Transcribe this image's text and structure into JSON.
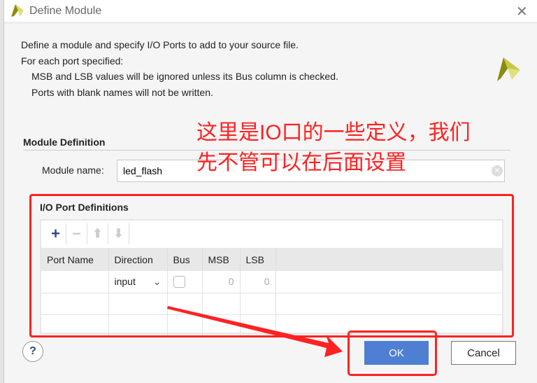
{
  "window": {
    "title": "Define Module",
    "close_icon": "close-icon",
    "logo_icon": "vivado-logo-icon"
  },
  "intro": {
    "lines": [
      "Define a module and specify I/O Ports to add to your source file.",
      "For each port specified:",
      "MSB and LSB values will be ignored unless its Bus column is checked.",
      "Ports with blank names will not be written."
    ]
  },
  "module_definition": {
    "heading": "Module Definition",
    "label": "Module name:",
    "value": "led_flash"
  },
  "io_ports": {
    "heading": "I/O Port Definitions",
    "toolbar": {
      "add": "+",
      "remove": "−",
      "up": "⬆",
      "down": "⬇"
    },
    "columns": [
      "Port Name",
      "Direction",
      "Bus",
      "MSB",
      "LSB"
    ],
    "rows": [
      {
        "port_name": "",
        "direction": "input",
        "bus": false,
        "msb": "0",
        "lsb": "0"
      }
    ]
  },
  "buttons": {
    "help": "?",
    "ok": "OK",
    "cancel": "Cancel"
  },
  "annotation": {
    "text": "这里是IO口的一些定义，我们先不管可以在后面设置",
    "color": "#ff2222"
  },
  "colors": {
    "accent": "#4e7fd3",
    "annotation": "#ff2222"
  }
}
